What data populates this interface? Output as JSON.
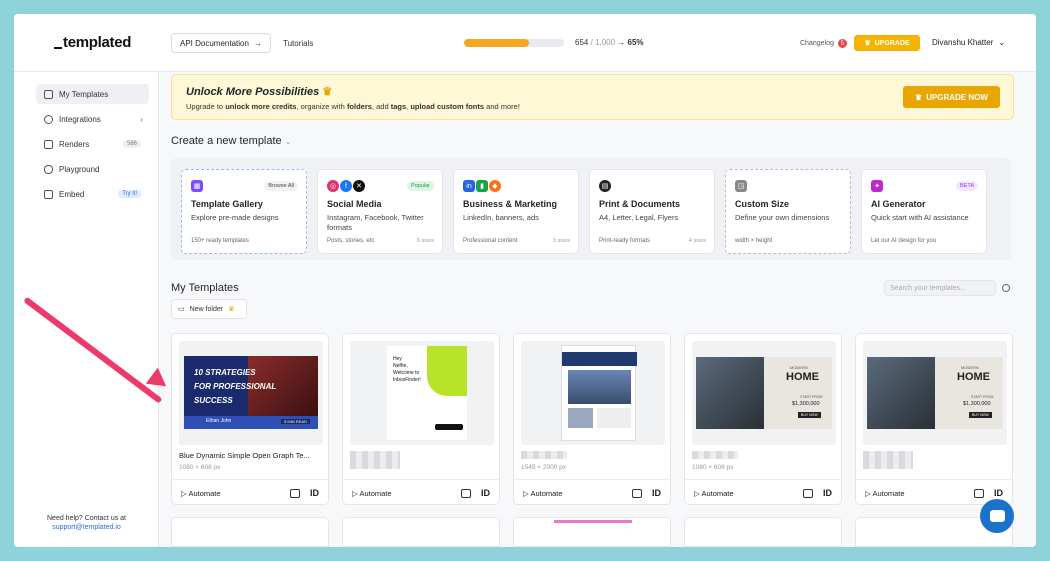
{
  "header": {
    "logo": "templated",
    "api_docs": "API Documentation",
    "tutorials": "Tutorials",
    "usage_used": "654",
    "usage_total": "/ 1,000",
    "usage_percent_label": "→ 65%",
    "usage_fraction": 0.654,
    "changelog": "Changelog",
    "changelog_count": "5",
    "upgrade": "UPGRADE",
    "user": "Divanshu Khatter"
  },
  "sidebar": {
    "items": [
      {
        "label": "My Templates",
        "icon": "templates-icon",
        "active": true
      },
      {
        "label": "Integrations",
        "icon": "integrations-icon",
        "extra": "›"
      },
      {
        "label": "Renders",
        "icon": "renders-icon",
        "extra": "586"
      },
      {
        "label": "Playground",
        "icon": "playground-icon"
      },
      {
        "label": "Embed",
        "icon": "embed-icon",
        "extra": "Try it!"
      }
    ],
    "help_text": "Need help? Contact us at",
    "help_email": "support@templated.io"
  },
  "banner": {
    "title": "Unlock More Possibilities",
    "text_parts": [
      "Upgrade to ",
      "unlock more credits",
      ", organize with ",
      "folders",
      ", add ",
      "tags",
      ", ",
      "upload custom fonts",
      " and more!"
    ],
    "cta": "UPGRADE NOW"
  },
  "create": {
    "title": "Create a new template",
    "cards": [
      {
        "title": "Template Gallery",
        "tag": "Browse All",
        "desc": "Explore pre-made designs",
        "foot": "150+ ready templates",
        "footr": ""
      },
      {
        "title": "Social Media",
        "tag": "Popular",
        "desc": "Instagram, Facebook, Twitter formats",
        "foot": "Posts, stories, etc",
        "footr": "6 sizes"
      },
      {
        "title": "Business & Marketing",
        "tag": "",
        "desc": "LinkedIn, banners, ads",
        "foot": "Professional content",
        "footr": "3 sizes"
      },
      {
        "title": "Print & Documents",
        "tag": "",
        "desc": "A4, Letter, Legal, Flyers",
        "foot": "Print-ready formats",
        "footr": "4 sizes"
      },
      {
        "title": "Custom Size",
        "tag": "",
        "desc": "Define your own dimensions",
        "foot": "width × height",
        "footr": ""
      },
      {
        "title": "AI Generator",
        "tag": "BETA",
        "desc": "Quick start with AI assistance",
        "foot": "Let our AI design for you",
        "footr": ""
      }
    ]
  },
  "my_templates": {
    "title": "My Templates",
    "search_placeholder": "Search your templates...",
    "new_folder": "New folder",
    "templates": [
      {
        "name": "Blue Dynamic Simple Open Graph Te...",
        "size": "1080 × 608 px"
      },
      {
        "name": "",
        "size": ""
      },
      {
        "name": "",
        "size": "1545 × 2000 px"
      },
      {
        "name": "",
        "size": "1080 × 608 px"
      },
      {
        "name": "",
        "size": ""
      }
    ],
    "automate_label": "Automate",
    "id_label": "ID"
  },
  "thumb_text": {
    "og_line1": "10 STRATEGIES",
    "og_line2": "FOR PROFESSIONAL",
    "og_line3": "SUCCESS",
    "og_author": "Ethan John",
    "og_read": "5 MIN READ",
    "welcome_hey": "Hey",
    "welcome_name": "Nefhe,",
    "welcome_line1": "Welcome to",
    "welcome_line2": "InboxFinder!",
    "home_small": "MODERN",
    "home_big": "HOME",
    "home_price_label": "START FROM",
    "home_price": "$1,300,000",
    "home_buy": "BUY NOW"
  },
  "colors": {
    "accent": "#f6b400",
    "progress": "#f5a623",
    "arrow": "#ee3a6a",
    "chat": "#1a73c9"
  }
}
